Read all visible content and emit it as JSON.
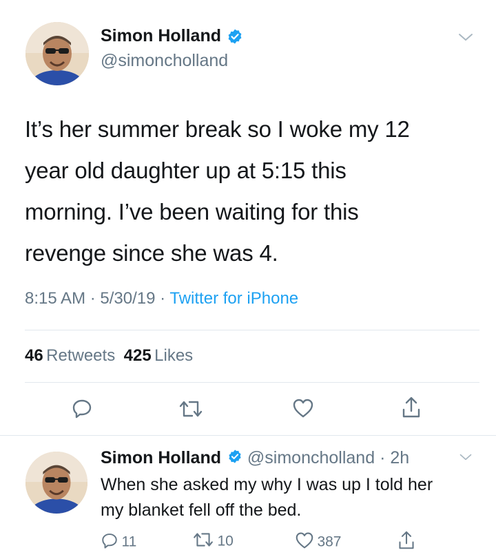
{
  "main_tweet": {
    "author_name": "Simon Holland",
    "author_handle": "@simoncholland",
    "text_lines": [
      "It’s her summer break so I woke my 12",
      "year old daughter up at 5:15 this",
      "morning. I’ve been waiting for this",
      "revenge since she was 4."
    ],
    "time": "8:15 AM",
    "date": "5/30/19",
    "source": "Twitter for iPhone",
    "separator": "·",
    "retweets_count": "46",
    "retweets_label": "Retweets",
    "likes_count": "425",
    "likes_label": "Likes"
  },
  "reply_tweet": {
    "author_name": "Simon Holland",
    "author_handle": "@simoncholland",
    "time_ago": "2h",
    "separator": "·",
    "text_lines": [
      "When she asked my why I was up I told her",
      "my blanket fell off the bed."
    ],
    "reply_count": "11",
    "retweet_count": "10",
    "like_count": "387"
  },
  "icons": {
    "verified": "verified-badge-icon",
    "chevron": "chevron-down-icon",
    "reply": "reply-icon",
    "retweet": "retweet-icon",
    "like": "heart-icon",
    "share": "share-icon"
  },
  "colors": {
    "text": "#14171a",
    "secondary": "#657786",
    "link": "#1da1f2",
    "divider": "#e1e8ed"
  }
}
